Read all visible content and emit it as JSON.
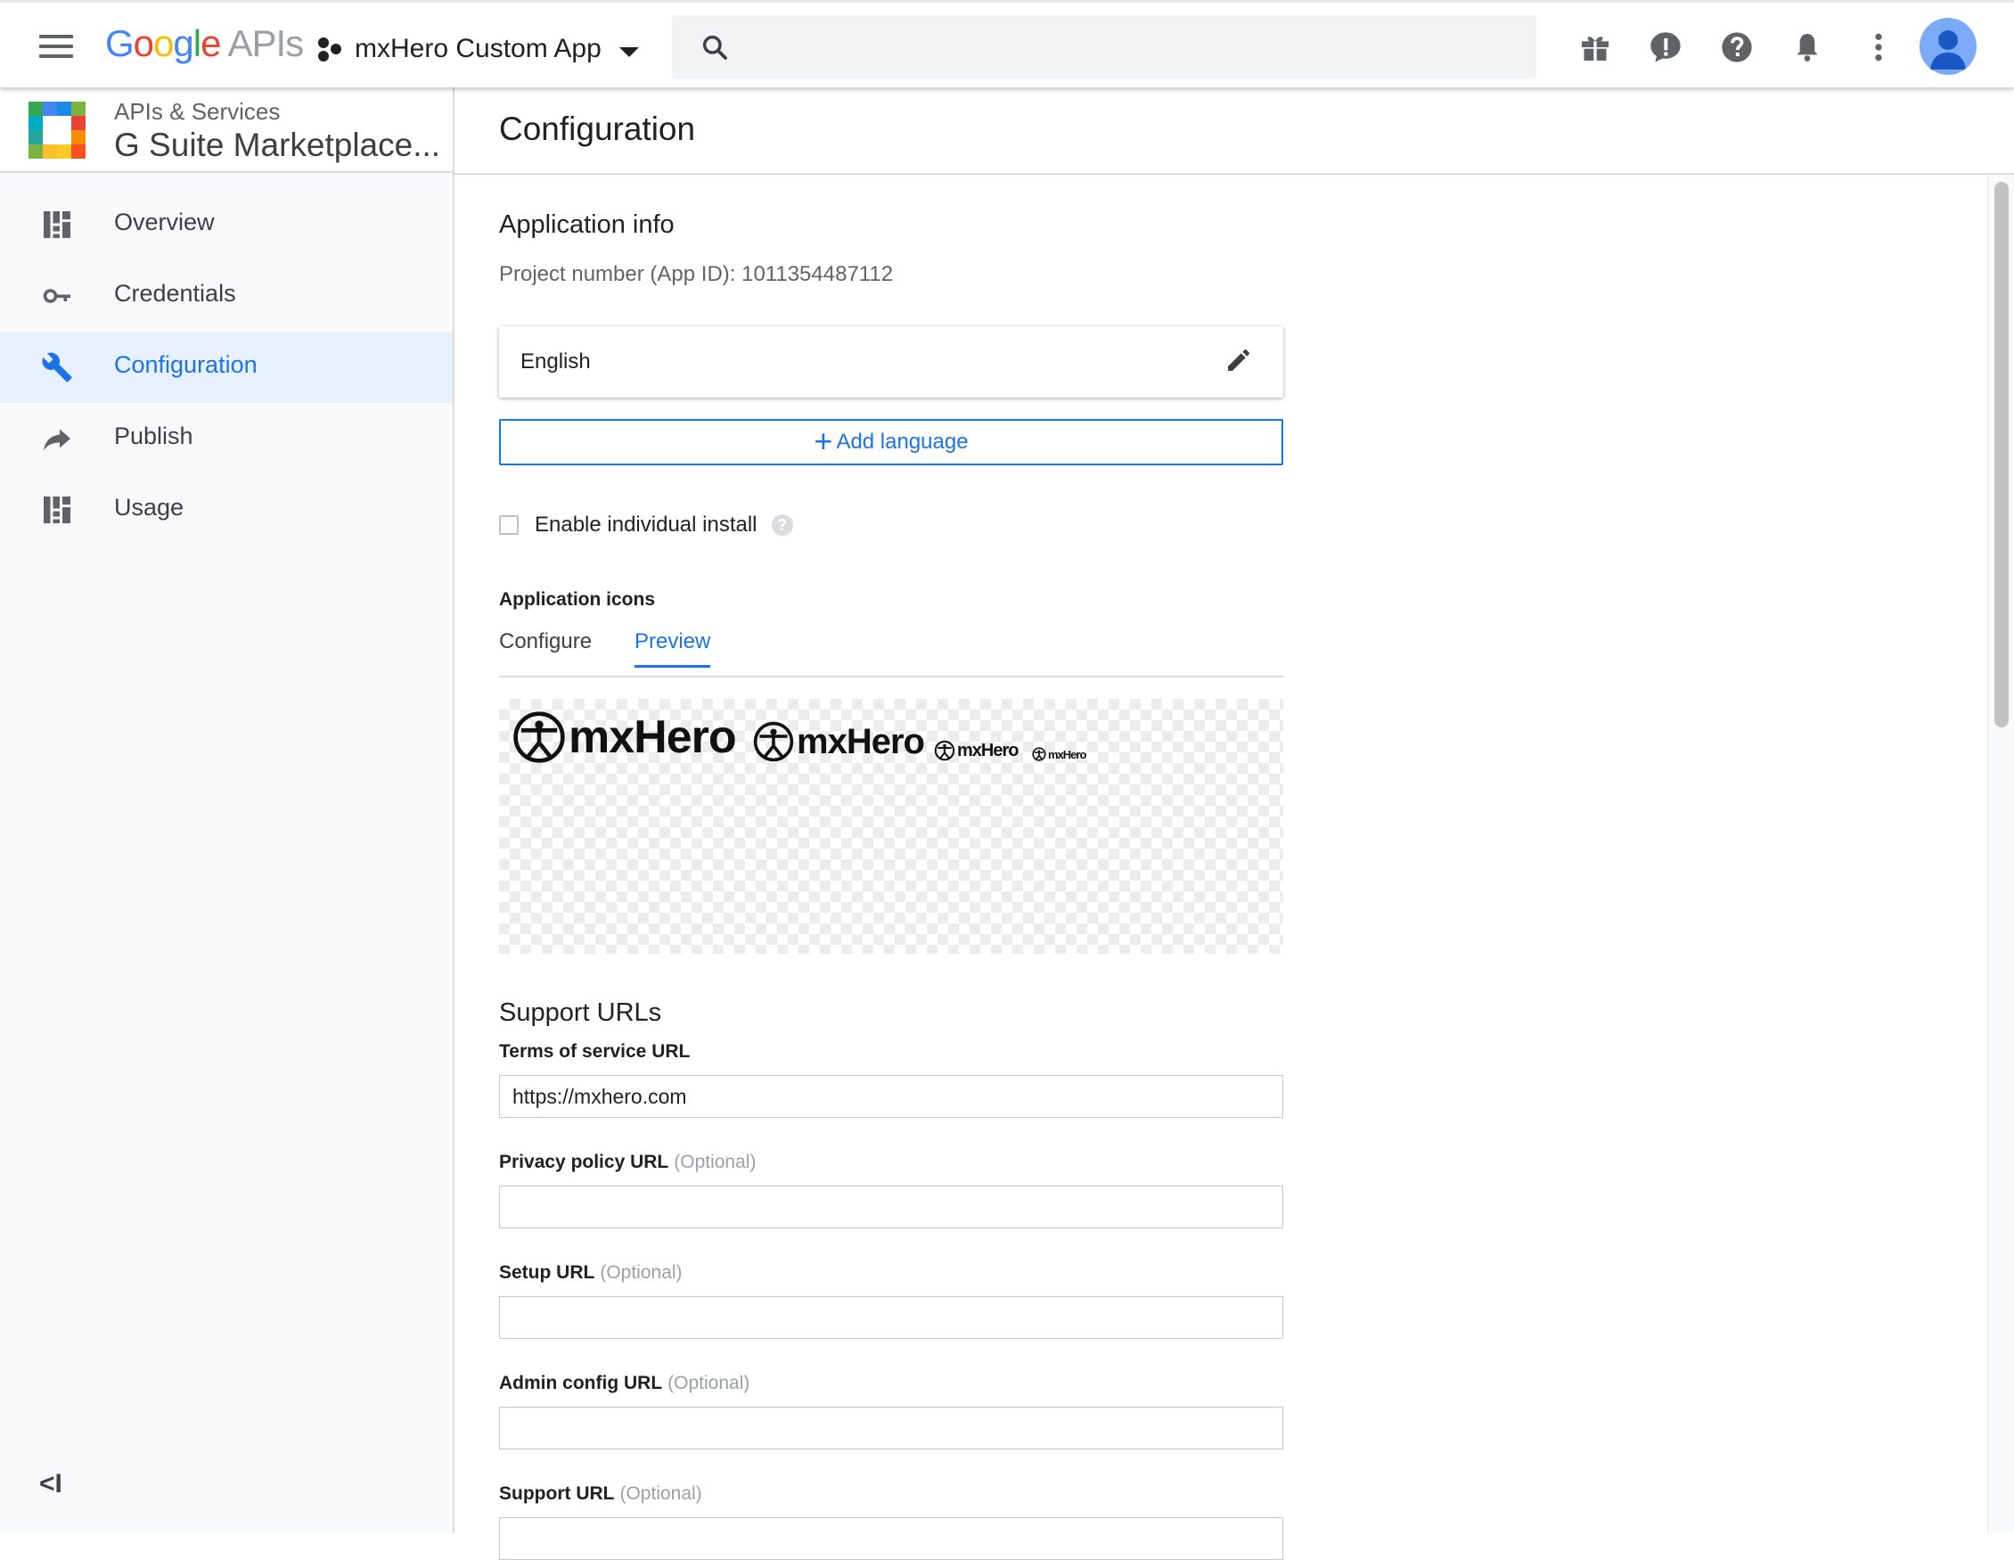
{
  "topbar": {
    "logo_google": "Google",
    "logo_apis": "APIs",
    "project_name": "mxHero Custom App",
    "search_placeholder": ""
  },
  "sidebar": {
    "header_sub": "APIs & Services",
    "header_title": "G Suite Marketplace...",
    "items": [
      {
        "label": "Overview",
        "icon": "dashboard-icon"
      },
      {
        "label": "Credentials",
        "icon": "key-icon"
      },
      {
        "label": "Configuration",
        "icon": "wrench-icon",
        "active": true
      },
      {
        "label": "Publish",
        "icon": "share-arrow-icon"
      },
      {
        "label": "Usage",
        "icon": "dashboard-icon"
      }
    ],
    "collapse_label": "<I"
  },
  "main": {
    "title": "Configuration",
    "app_info": {
      "title": "Application info",
      "project_number": "Project number (App ID): 1011354487112",
      "language": "English",
      "add_language": "Add language",
      "individual_install": "Enable individual install",
      "individual_install_checked": false
    },
    "app_icons": {
      "title": "Application icons",
      "tabs": [
        "Configure",
        "Preview"
      ],
      "active_tab": "Preview",
      "preview_text": "mxHero"
    },
    "support": {
      "title": "Support URLs",
      "fields": [
        {
          "label": "Terms of service URL",
          "optional": "",
          "value": "https://mxhero.com"
        },
        {
          "label": "Privacy policy URL",
          "optional": "(Optional)",
          "value": ""
        },
        {
          "label": "Setup URL",
          "optional": "(Optional)",
          "value": ""
        },
        {
          "label": "Admin config URL",
          "optional": "(Optional)",
          "value": ""
        },
        {
          "label": "Support URL",
          "optional": "(Optional)",
          "value": ""
        }
      ]
    }
  },
  "colors": {
    "accent": "#1a73e8",
    "active_nav_bg": "#e8f0fe",
    "sidebar_bg": "#f8f9fa"
  }
}
